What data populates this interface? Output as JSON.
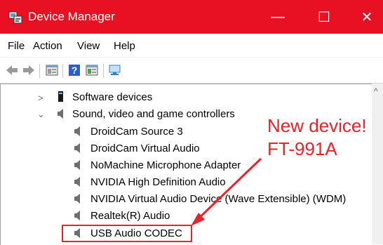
{
  "window": {
    "title": "Device Manager",
    "minimize_glyph": "—",
    "maximize_glyph": "☐",
    "close_glyph": "✕"
  },
  "menu": [
    "File",
    "Action",
    "View",
    "Help"
  ],
  "toolbar": [
    "back-icon",
    "forward-icon",
    "properties-icon",
    "help-icon",
    "update-driver-icon",
    "scan-hardware-icon"
  ],
  "tree": {
    "software_devices": "Software devices",
    "sound_category": "Sound, video and game controllers",
    "sound_items": [
      "DroidCam Source 3",
      "DroidCam Virtual Audio",
      "NoMachine Microphone Adapter",
      "NVIDIA High Definition Audio",
      "NVIDIA Virtual Audio Device (Wave Extensible) (WDM)",
      "Realtek(R) Audio",
      "USB Audio CODEC"
    ]
  },
  "annotation": {
    "line1": "New device!",
    "line2": "FT-991A"
  },
  "colors": {
    "titlebar": "#e81123",
    "annotation": "#e8232b"
  }
}
